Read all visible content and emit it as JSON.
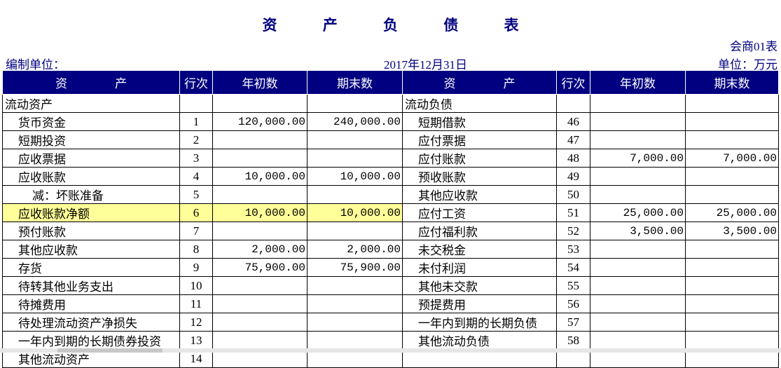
{
  "title": "资 产 负 债 表",
  "form_code": "会商01表",
  "preparer_label": "编制单位：",
  "date": "2017年12月31日",
  "unit": "单位：万元",
  "headers": {
    "asset": "资　　　　产",
    "line": "行次",
    "begin": "年初数",
    "end": "期末数",
    "liab": "资　　　　产",
    "line2": "行次",
    "begin2": "年初数",
    "end2": "期末数"
  },
  "rows": [
    {
      "a_name": "流动资产",
      "a_line": "",
      "a_begin": "",
      "a_end": "",
      "l_name": "流动负债",
      "l_line": "",
      "l_begin": "",
      "l_end": ""
    },
    {
      "a_name": "货币资金",
      "a_line": "1",
      "a_begin": "120,000.00",
      "a_end": "240,000.00",
      "l_name": "短期借款",
      "l_line": "46",
      "l_begin": "",
      "l_end": ""
    },
    {
      "a_name": "短期投资",
      "a_line": "2",
      "a_begin": "",
      "a_end": "",
      "l_name": "应付票据",
      "l_line": "47",
      "l_begin": "",
      "l_end": ""
    },
    {
      "a_name": "应收票据",
      "a_line": "3",
      "a_begin": "",
      "a_end": "",
      "l_name": "应付账款",
      "l_line": "48",
      "l_begin": "7,000.00",
      "l_end": "7,000.00"
    },
    {
      "a_name": "应收账款",
      "a_line": "4",
      "a_begin": "10,000.00",
      "a_end": "10,000.00",
      "l_name": "预收账款",
      "l_line": "49",
      "l_begin": "",
      "l_end": ""
    },
    {
      "a_name": "减：坏账准备",
      "a_line": "5",
      "a_begin": "",
      "a_end": "",
      "l_name": "其他应收款",
      "l_line": "50",
      "l_begin": "",
      "l_end": ""
    },
    {
      "a_name": "应收账款净额",
      "a_line": "6",
      "a_begin": "10,000.00",
      "a_end": "10,000.00",
      "l_name": "应付工资",
      "l_line": "51",
      "l_begin": "25,000.00",
      "l_end": "25,000.00"
    },
    {
      "a_name": "预付账款",
      "a_line": "7",
      "a_begin": "",
      "a_end": "",
      "l_name": "应付福利款",
      "l_line": "52",
      "l_begin": "3,500.00",
      "l_end": "3,500.00"
    },
    {
      "a_name": "其他应收款",
      "a_line": "8",
      "a_begin": "2,000.00",
      "a_end": "2,000.00",
      "l_name": "未交税金",
      "l_line": "53",
      "l_begin": "",
      "l_end": ""
    },
    {
      "a_name": "存货",
      "a_line": "9",
      "a_begin": "75,900.00",
      "a_end": "75,900.00",
      "l_name": "未付利润",
      "l_line": "54",
      "l_begin": "",
      "l_end": ""
    },
    {
      "a_name": "待转其他业务支出",
      "a_line": "10",
      "a_begin": "",
      "a_end": "",
      "l_name": "其他未交款",
      "l_line": "55",
      "l_begin": "",
      "l_end": ""
    },
    {
      "a_name": "待摊费用",
      "a_line": "11",
      "a_begin": "",
      "a_end": "",
      "l_name": "预提费用",
      "l_line": "56",
      "l_begin": "",
      "l_end": ""
    },
    {
      "a_name": "待处理流动资产净损失",
      "a_line": "12",
      "a_begin": "",
      "a_end": "",
      "l_name": "一年内到期的长期负债",
      "l_line": "57",
      "l_begin": "",
      "l_end": ""
    },
    {
      "a_name": "一年内到期的长期债券投资",
      "a_line": "13",
      "a_begin": "",
      "a_end": "",
      "l_name": "其他流动负债",
      "l_line": "58",
      "l_begin": "",
      "l_end": ""
    },
    {
      "a_name": "其他流动资产",
      "a_line": "14",
      "a_begin": "",
      "a_end": "",
      "l_name": "",
      "l_line": "",
      "l_begin": "",
      "l_end": ""
    }
  ]
}
